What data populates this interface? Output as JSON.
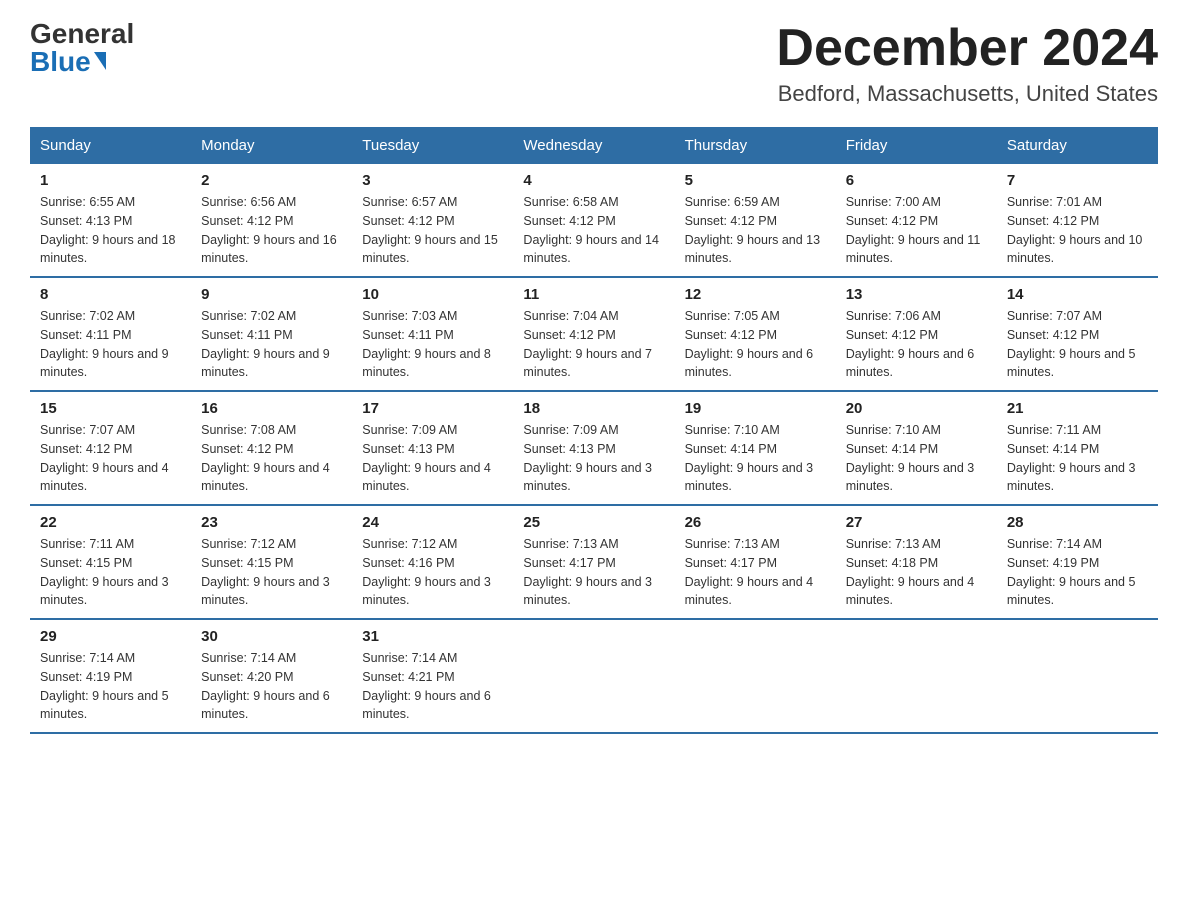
{
  "header": {
    "logo_general": "General",
    "logo_blue": "Blue",
    "month_title": "December 2024",
    "location": "Bedford, Massachusetts, United States"
  },
  "weekdays": [
    "Sunday",
    "Monday",
    "Tuesday",
    "Wednesday",
    "Thursday",
    "Friday",
    "Saturday"
  ],
  "weeks": [
    [
      {
        "day": "1",
        "sunrise": "6:55 AM",
        "sunset": "4:13 PM",
        "daylight": "9 hours and 18 minutes."
      },
      {
        "day": "2",
        "sunrise": "6:56 AM",
        "sunset": "4:12 PM",
        "daylight": "9 hours and 16 minutes."
      },
      {
        "day": "3",
        "sunrise": "6:57 AM",
        "sunset": "4:12 PM",
        "daylight": "9 hours and 15 minutes."
      },
      {
        "day": "4",
        "sunrise": "6:58 AM",
        "sunset": "4:12 PM",
        "daylight": "9 hours and 14 minutes."
      },
      {
        "day": "5",
        "sunrise": "6:59 AM",
        "sunset": "4:12 PM",
        "daylight": "9 hours and 13 minutes."
      },
      {
        "day": "6",
        "sunrise": "7:00 AM",
        "sunset": "4:12 PM",
        "daylight": "9 hours and 11 minutes."
      },
      {
        "day": "7",
        "sunrise": "7:01 AM",
        "sunset": "4:12 PM",
        "daylight": "9 hours and 10 minutes."
      }
    ],
    [
      {
        "day": "8",
        "sunrise": "7:02 AM",
        "sunset": "4:11 PM",
        "daylight": "9 hours and 9 minutes."
      },
      {
        "day": "9",
        "sunrise": "7:02 AM",
        "sunset": "4:11 PM",
        "daylight": "9 hours and 9 minutes."
      },
      {
        "day": "10",
        "sunrise": "7:03 AM",
        "sunset": "4:11 PM",
        "daylight": "9 hours and 8 minutes."
      },
      {
        "day": "11",
        "sunrise": "7:04 AM",
        "sunset": "4:12 PM",
        "daylight": "9 hours and 7 minutes."
      },
      {
        "day": "12",
        "sunrise": "7:05 AM",
        "sunset": "4:12 PM",
        "daylight": "9 hours and 6 minutes."
      },
      {
        "day": "13",
        "sunrise": "7:06 AM",
        "sunset": "4:12 PM",
        "daylight": "9 hours and 6 minutes."
      },
      {
        "day": "14",
        "sunrise": "7:07 AM",
        "sunset": "4:12 PM",
        "daylight": "9 hours and 5 minutes."
      }
    ],
    [
      {
        "day": "15",
        "sunrise": "7:07 AM",
        "sunset": "4:12 PM",
        "daylight": "9 hours and 4 minutes."
      },
      {
        "day": "16",
        "sunrise": "7:08 AM",
        "sunset": "4:12 PM",
        "daylight": "9 hours and 4 minutes."
      },
      {
        "day": "17",
        "sunrise": "7:09 AM",
        "sunset": "4:13 PM",
        "daylight": "9 hours and 4 minutes."
      },
      {
        "day": "18",
        "sunrise": "7:09 AM",
        "sunset": "4:13 PM",
        "daylight": "9 hours and 3 minutes."
      },
      {
        "day": "19",
        "sunrise": "7:10 AM",
        "sunset": "4:14 PM",
        "daylight": "9 hours and 3 minutes."
      },
      {
        "day": "20",
        "sunrise": "7:10 AM",
        "sunset": "4:14 PM",
        "daylight": "9 hours and 3 minutes."
      },
      {
        "day": "21",
        "sunrise": "7:11 AM",
        "sunset": "4:14 PM",
        "daylight": "9 hours and 3 minutes."
      }
    ],
    [
      {
        "day": "22",
        "sunrise": "7:11 AM",
        "sunset": "4:15 PM",
        "daylight": "9 hours and 3 minutes."
      },
      {
        "day": "23",
        "sunrise": "7:12 AM",
        "sunset": "4:15 PM",
        "daylight": "9 hours and 3 minutes."
      },
      {
        "day": "24",
        "sunrise": "7:12 AM",
        "sunset": "4:16 PM",
        "daylight": "9 hours and 3 minutes."
      },
      {
        "day": "25",
        "sunrise": "7:13 AM",
        "sunset": "4:17 PM",
        "daylight": "9 hours and 3 minutes."
      },
      {
        "day": "26",
        "sunrise": "7:13 AM",
        "sunset": "4:17 PM",
        "daylight": "9 hours and 4 minutes."
      },
      {
        "day": "27",
        "sunrise": "7:13 AM",
        "sunset": "4:18 PM",
        "daylight": "9 hours and 4 minutes."
      },
      {
        "day": "28",
        "sunrise": "7:14 AM",
        "sunset": "4:19 PM",
        "daylight": "9 hours and 5 minutes."
      }
    ],
    [
      {
        "day": "29",
        "sunrise": "7:14 AM",
        "sunset": "4:19 PM",
        "daylight": "9 hours and 5 minutes."
      },
      {
        "day": "30",
        "sunrise": "7:14 AM",
        "sunset": "4:20 PM",
        "daylight": "9 hours and 6 minutes."
      },
      {
        "day": "31",
        "sunrise": "7:14 AM",
        "sunset": "4:21 PM",
        "daylight": "9 hours and 6 minutes."
      },
      null,
      null,
      null,
      null
    ]
  ]
}
